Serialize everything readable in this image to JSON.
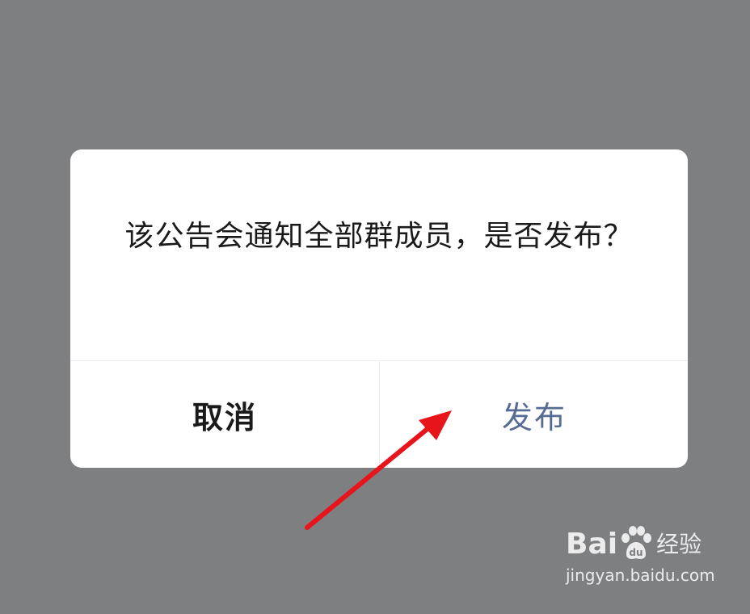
{
  "dialog": {
    "message": "该公告会通知全部群成员，是否发布？",
    "cancel_label": "取消",
    "confirm_label": "发布"
  },
  "colors": {
    "overlay": "#7e7f81",
    "confirm_text": "#576b95",
    "cancel_text": "#1a1a1a",
    "arrow": "#e8141b"
  },
  "watermark": {
    "brand_latin_1": "Bai",
    "brand_latin_2": "du",
    "brand_cn": "经验",
    "url": "jingyan.baidu.com",
    "icon": "paw-icon"
  },
  "annotation": {
    "icon": "red-arrow-icon"
  }
}
